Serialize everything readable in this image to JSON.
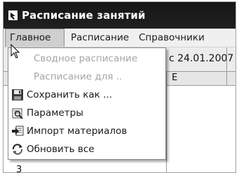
{
  "window": {
    "title": "Расписание занятий"
  },
  "menubar": {
    "items": [
      "Главное",
      "Расписание",
      "Справочники"
    ]
  },
  "toolbar": {
    "date_text": "с  24.01.2007"
  },
  "grid": {
    "column_header": "E",
    "row_number": "3"
  },
  "dropdown": {
    "items": [
      {
        "label": "Сводное расписание",
        "enabled": false,
        "icon": ""
      },
      {
        "label": "Расписание для ..",
        "enabled": false,
        "icon": ""
      },
      {
        "label": "Сохранить как ...",
        "enabled": true,
        "icon": "floppy-disk-icon"
      },
      {
        "label": "Параметры",
        "enabled": true,
        "icon": "parameters-icon"
      },
      {
        "label": "Импорт материалов",
        "enabled": true,
        "icon": "import-icon"
      },
      {
        "label": "Обновить все",
        "enabled": true,
        "icon": "refresh-icon"
      }
    ]
  },
  "colors": {
    "titlebar": "#1b1b1b",
    "menu_active": "#cfcfcf",
    "disabled_text": "#a5a5a5"
  }
}
